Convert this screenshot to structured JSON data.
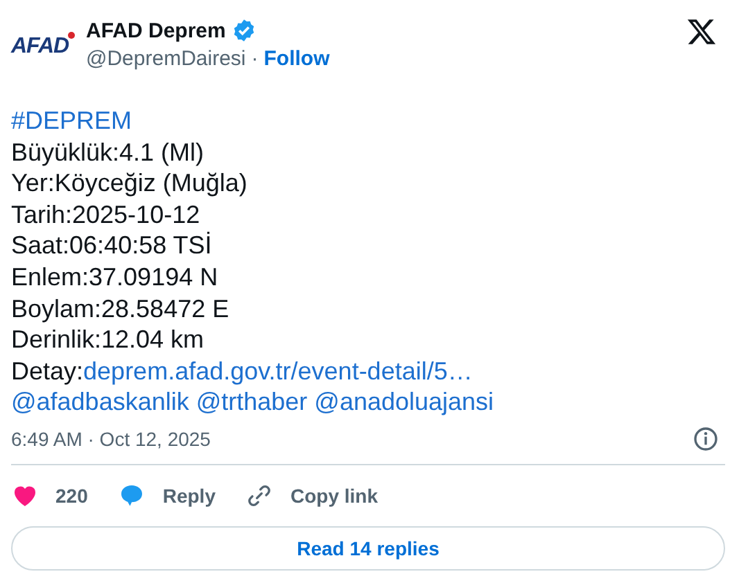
{
  "author": {
    "logo_text": "AFAD",
    "name": "AFAD Deprem",
    "verified": true,
    "handle": "@DepremDairesi",
    "separator": "·",
    "follow": "Follow"
  },
  "body": [
    [
      {
        "text": "#DEPREM",
        "link": true
      }
    ],
    [
      {
        "text": "Büyüklük:4.1 (Ml)",
        "link": false
      }
    ],
    [
      {
        "text": "Yer:Köyceğiz (Muğla)",
        "link": false
      }
    ],
    [
      {
        "text": "Tarih:2025-10-12",
        "link": false
      }
    ],
    [
      {
        "text": "Saat:06:40:58 TSİ",
        "link": false
      }
    ],
    [
      {
        "text": "Enlem:37.09194 N",
        "link": false
      }
    ],
    [
      {
        "text": "Boylam:28.58472 E",
        "link": false
      }
    ],
    [
      {
        "text": "Derinlik:12.04 km",
        "link": false
      }
    ],
    [
      {
        "text": "Detay:",
        "link": false
      },
      {
        "text": "deprem.afad.gov.tr/event-detail/5…",
        "link": true
      }
    ],
    [
      {
        "text": "@afadbaskanlik",
        "link": true
      },
      {
        "text": "@trthaber",
        "link": true
      },
      {
        "text": "@anadoluajansi",
        "link": true
      }
    ]
  ],
  "timestamp": "6:49 AM · Oct 12, 2025",
  "actions": {
    "likes": "220",
    "reply": "Reply",
    "copy_link": "Copy link"
  },
  "read_replies": "Read 14 replies"
}
